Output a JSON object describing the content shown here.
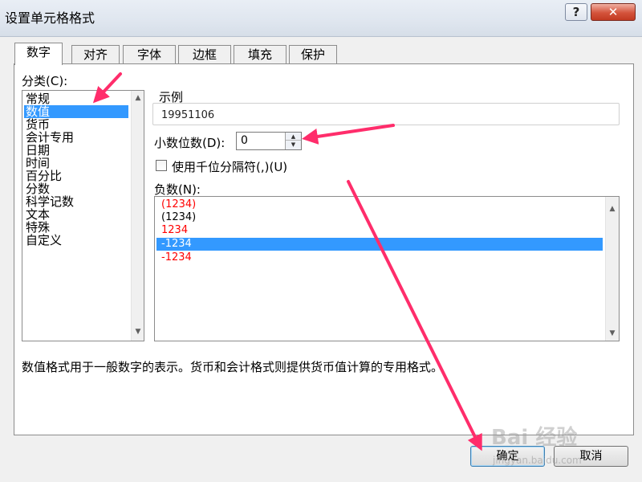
{
  "window": {
    "title": "设置单元格格式",
    "help_label": "?",
    "close_label": "✕"
  },
  "tabs": [
    {
      "label": "数字",
      "active": true
    },
    {
      "label": "对齐"
    },
    {
      "label": "字体"
    },
    {
      "label": "边框"
    },
    {
      "label": "填充"
    },
    {
      "label": "保护"
    }
  ],
  "category": {
    "label": "分类(C):",
    "items": [
      "常规",
      "数值",
      "货币",
      "会计专用",
      "日期",
      "时间",
      "百分比",
      "分数",
      "科学记数",
      "文本",
      "特殊",
      "自定义"
    ],
    "selected": "数值"
  },
  "sample": {
    "label": "示例",
    "value": "19951106"
  },
  "decimal": {
    "label": "小数位数(D):",
    "value": "0"
  },
  "thousands": {
    "label": "使用千位分隔符(,)(U)",
    "checked": false
  },
  "negative": {
    "label": "负数(N):",
    "items": [
      {
        "text": "(1234)",
        "color": "#ff0000"
      },
      {
        "text": "(1234)",
        "color": "#000000"
      },
      {
        "text": "1234",
        "color": "#ff0000"
      },
      {
        "text": "-1234",
        "color": "#000000",
        "selected": true
      },
      {
        "text": "-1234",
        "color": "#ff0000"
      }
    ]
  },
  "description": "数值格式用于一般数字的表示。货币和会计格式则提供货币值计算的专用格式。",
  "buttons": {
    "ok": "确定",
    "cancel": "取消"
  },
  "watermark": {
    "text": "Bai 经验",
    "url": "jingyan.baidu.com"
  },
  "colors": {
    "selection": "#3399ff",
    "annotation_arrow": "#ff2d6b"
  }
}
